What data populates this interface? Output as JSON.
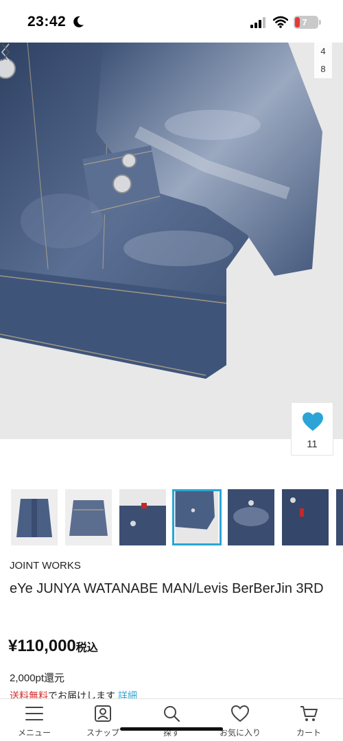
{
  "status_bar": {
    "time": "23:42",
    "battery_level": "7",
    "icons": [
      "moon-icon",
      "signal-icon",
      "wifi-icon",
      "battery-icon"
    ]
  },
  "gallery": {
    "counter_top": "4",
    "counter_bottom": "8",
    "favorite_count": "11",
    "icons": [
      "heart-icon",
      "chevron-right-icon",
      "chevron-left-icon"
    ],
    "thumbnails": [
      {
        "selected": false
      },
      {
        "selected": false
      },
      {
        "selected": false
      },
      {
        "selected": true
      },
      {
        "selected": false
      },
      {
        "selected": false
      },
      {
        "selected": false
      }
    ]
  },
  "product": {
    "brand": "JOINT WORKS",
    "title": "eYe JUNYA WATANABE MAN/Levis BerBerJin 3RD",
    "price": "¥110,000",
    "price_tax": "税込",
    "points": "2,000pt還元",
    "shipping_free": "送料無料",
    "shipping_text": "でお届けします",
    "shipping_detail": "詳細"
  },
  "bottom_nav": {
    "items": [
      {
        "label": "メニュー",
        "icon": "menu-icon"
      },
      {
        "label": "スナップ",
        "icon": "snap-icon"
      },
      {
        "label": "探す",
        "icon": "search-icon"
      },
      {
        "label": "お気に入り",
        "icon": "heart-outline-icon"
      },
      {
        "label": "カート",
        "icon": "cart-icon"
      }
    ]
  },
  "colors": {
    "accent": "#2aa5d6",
    "sale_red": "#d32f2f",
    "denim": "#3d5478"
  }
}
